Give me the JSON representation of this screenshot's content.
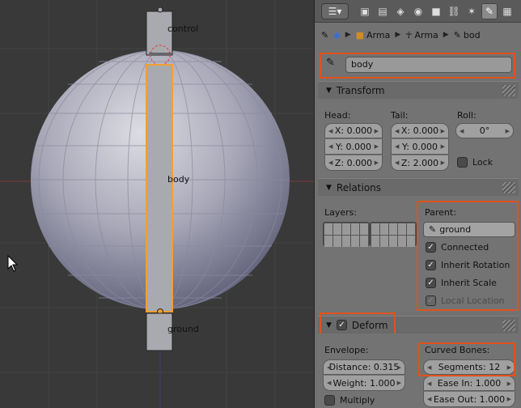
{
  "viewport": {
    "bone_control_label": "control",
    "bone_body_label": "body",
    "bone_ground_label": "ground",
    "colors": {
      "background": "#393939",
      "sphere_light": "#c9c9d4",
      "sphere_dark": "#6f6f86",
      "bone_fill": "#a9a9b0",
      "selected_outline": "#f0a030"
    }
  },
  "topbar": {
    "menu_icon": "editor-type-icon",
    "tabs": [
      {
        "name": "render-icon",
        "glyph": "▣"
      },
      {
        "name": "render-layers-icon",
        "glyph": "▤"
      },
      {
        "name": "scene-icon",
        "glyph": "◈"
      },
      {
        "name": "world-icon",
        "glyph": "◉"
      },
      {
        "name": "object-icon",
        "glyph": "■"
      },
      {
        "name": "constraints-icon",
        "glyph": "⛓"
      },
      {
        "name": "object-data-icon",
        "glyph": "✶"
      },
      {
        "name": "bone-icon",
        "glyph": "✎"
      },
      {
        "name": "material-icon",
        "glyph": "▦"
      },
      {
        "name": "texture-icon",
        "glyph": "◆"
      }
    ],
    "active_tab_index": 7
  },
  "breadcrumb": {
    "items": [
      {
        "icon": "pin-icon",
        "label": ""
      },
      {
        "icon": "scene-icon",
        "label": ""
      },
      {
        "icon": "object-icon",
        "label": "Arma"
      },
      {
        "icon": "armature-icon",
        "label": "Arma"
      },
      {
        "icon": "bone-icon",
        "label": "bod"
      }
    ]
  },
  "bone_name": {
    "value": "body"
  },
  "transform": {
    "title": "Transform",
    "head_label": "Head:",
    "tail_label": "Tail:",
    "roll_label": "Roll:",
    "head": {
      "x": "X: 0.000",
      "y": "Y: 0.000",
      "z": "Z: 0.000"
    },
    "tail": {
      "x": "X: 0.000",
      "y": "Y: 0.000",
      "z": "Z: 2.000"
    },
    "roll": "0°",
    "lock_label": "Lock",
    "lock_checked": false
  },
  "relations": {
    "title": "Relations",
    "layers_label": "Layers:",
    "parent_label": "Parent:",
    "parent_value": "ground",
    "connected_label": "Connected",
    "inherit_rotation_label": "Inherit Rotation",
    "inherit_scale_label": "Inherit Scale",
    "local_location_label": "Local Location",
    "connected": true,
    "inherit_rotation": true,
    "inherit_scale": true,
    "local_location": true
  },
  "deform": {
    "title": "Deform",
    "enabled": true,
    "envelope_label": "Envelope:",
    "distance": "Distance: 0.315",
    "weight": "Weight: 1.000",
    "multiply_label": "Multiply",
    "multiply_checked": false,
    "curved_bones_label": "Curved Bones:",
    "segments": "Segments: 12",
    "ease_in": "Ease In: 1.000",
    "ease_out": "Ease Out: 1.000"
  },
  "accent_color": "#e0521c"
}
